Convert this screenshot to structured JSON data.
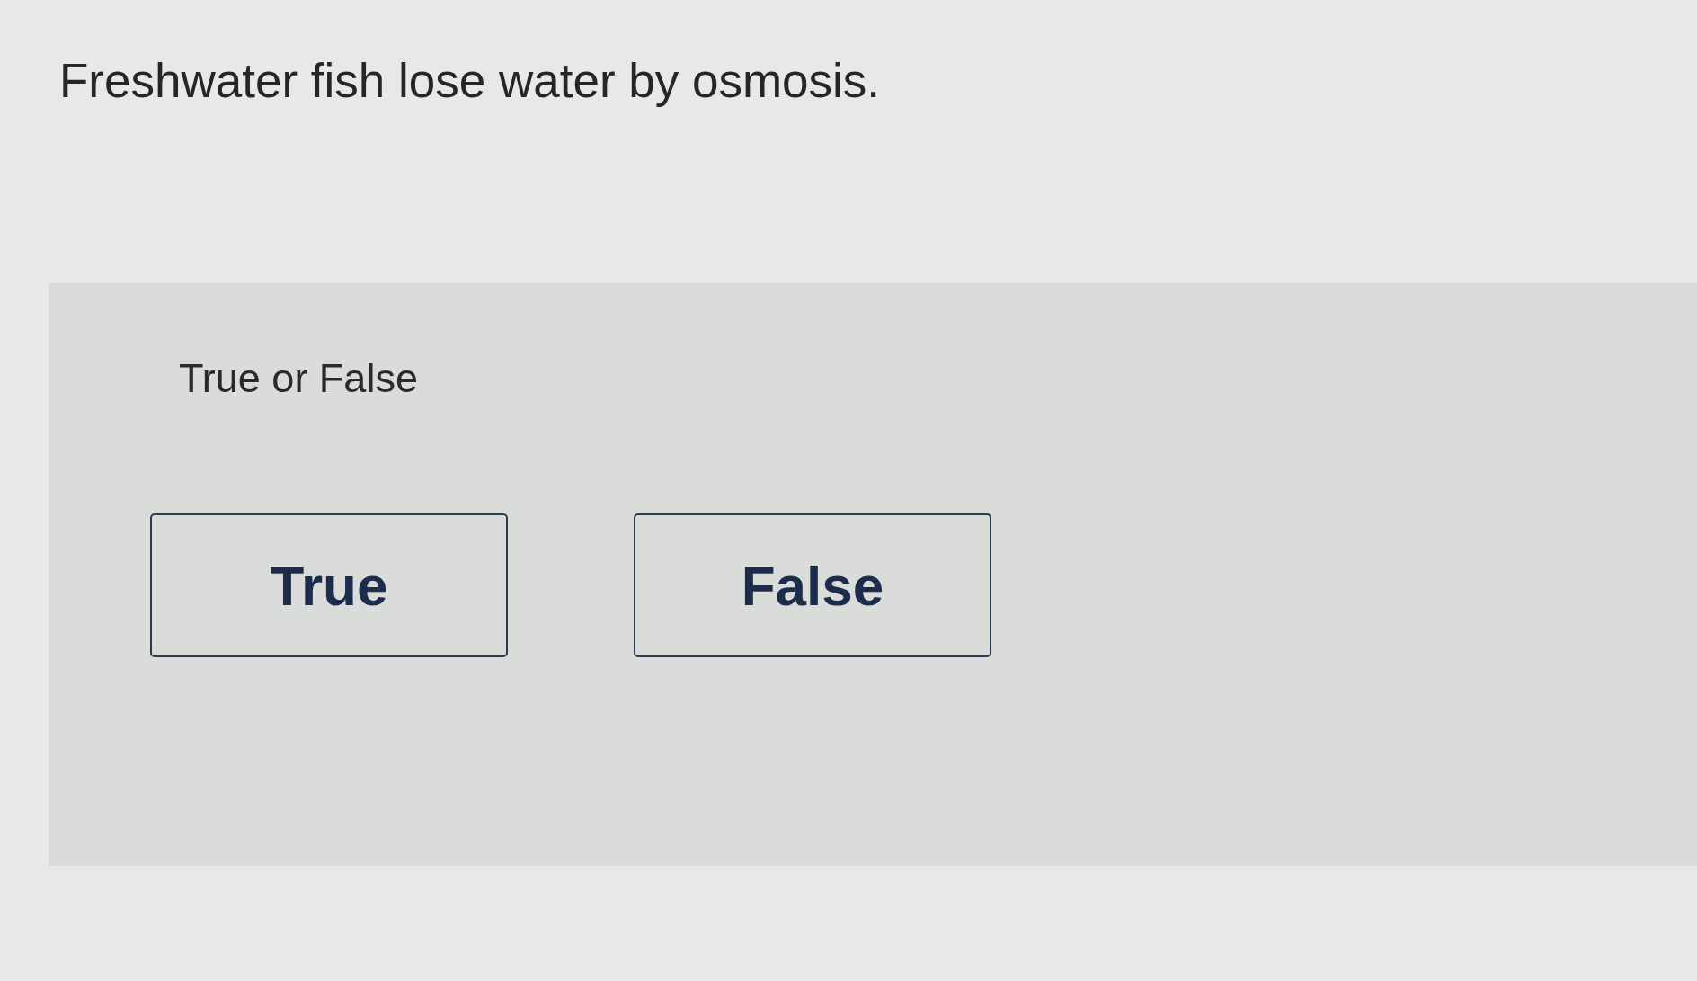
{
  "question": {
    "text": "Freshwater fish lose water by osmosis."
  },
  "answer_panel": {
    "prompt": "True or False",
    "options": [
      {
        "label": "True",
        "selected": false
      },
      {
        "label": "False",
        "selected": false
      }
    ]
  }
}
